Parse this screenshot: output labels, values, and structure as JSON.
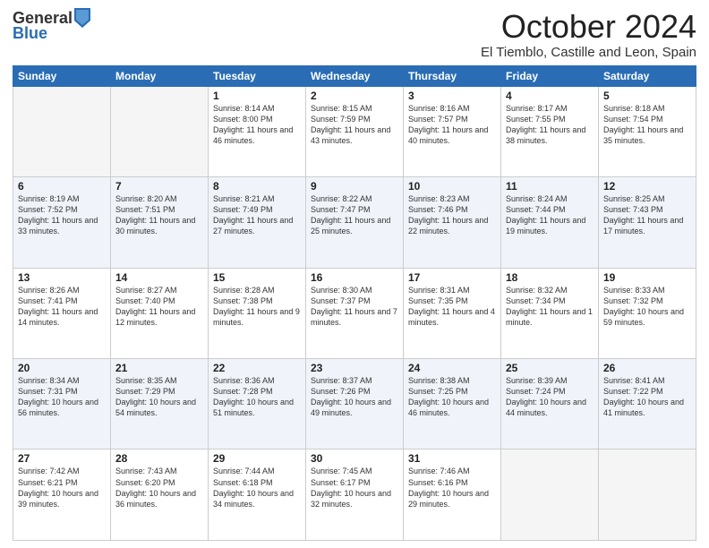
{
  "header": {
    "logo_general": "General",
    "logo_blue": "Blue",
    "month_title": "October 2024",
    "location": "El Tiemblo, Castille and Leon, Spain"
  },
  "days_of_week": [
    "Sunday",
    "Monday",
    "Tuesday",
    "Wednesday",
    "Thursday",
    "Friday",
    "Saturday"
  ],
  "weeks": [
    {
      "days": [
        {
          "num": "",
          "info": ""
        },
        {
          "num": "",
          "info": ""
        },
        {
          "num": "1",
          "info": "Sunrise: 8:14 AM\nSunset: 8:00 PM\nDaylight: 11 hours and 46 minutes."
        },
        {
          "num": "2",
          "info": "Sunrise: 8:15 AM\nSunset: 7:59 PM\nDaylight: 11 hours and 43 minutes."
        },
        {
          "num": "3",
          "info": "Sunrise: 8:16 AM\nSunset: 7:57 PM\nDaylight: 11 hours and 40 minutes."
        },
        {
          "num": "4",
          "info": "Sunrise: 8:17 AM\nSunset: 7:55 PM\nDaylight: 11 hours and 38 minutes."
        },
        {
          "num": "5",
          "info": "Sunrise: 8:18 AM\nSunset: 7:54 PM\nDaylight: 11 hours and 35 minutes."
        }
      ]
    },
    {
      "days": [
        {
          "num": "6",
          "info": "Sunrise: 8:19 AM\nSunset: 7:52 PM\nDaylight: 11 hours and 33 minutes."
        },
        {
          "num": "7",
          "info": "Sunrise: 8:20 AM\nSunset: 7:51 PM\nDaylight: 11 hours and 30 minutes."
        },
        {
          "num": "8",
          "info": "Sunrise: 8:21 AM\nSunset: 7:49 PM\nDaylight: 11 hours and 27 minutes."
        },
        {
          "num": "9",
          "info": "Sunrise: 8:22 AM\nSunset: 7:47 PM\nDaylight: 11 hours and 25 minutes."
        },
        {
          "num": "10",
          "info": "Sunrise: 8:23 AM\nSunset: 7:46 PM\nDaylight: 11 hours and 22 minutes."
        },
        {
          "num": "11",
          "info": "Sunrise: 8:24 AM\nSunset: 7:44 PM\nDaylight: 11 hours and 19 minutes."
        },
        {
          "num": "12",
          "info": "Sunrise: 8:25 AM\nSunset: 7:43 PM\nDaylight: 11 hours and 17 minutes."
        }
      ]
    },
    {
      "days": [
        {
          "num": "13",
          "info": "Sunrise: 8:26 AM\nSunset: 7:41 PM\nDaylight: 11 hours and 14 minutes."
        },
        {
          "num": "14",
          "info": "Sunrise: 8:27 AM\nSunset: 7:40 PM\nDaylight: 11 hours and 12 minutes."
        },
        {
          "num": "15",
          "info": "Sunrise: 8:28 AM\nSunset: 7:38 PM\nDaylight: 11 hours and 9 minutes."
        },
        {
          "num": "16",
          "info": "Sunrise: 8:30 AM\nSunset: 7:37 PM\nDaylight: 11 hours and 7 minutes."
        },
        {
          "num": "17",
          "info": "Sunrise: 8:31 AM\nSunset: 7:35 PM\nDaylight: 11 hours and 4 minutes."
        },
        {
          "num": "18",
          "info": "Sunrise: 8:32 AM\nSunset: 7:34 PM\nDaylight: 11 hours and 1 minute."
        },
        {
          "num": "19",
          "info": "Sunrise: 8:33 AM\nSunset: 7:32 PM\nDaylight: 10 hours and 59 minutes."
        }
      ]
    },
    {
      "days": [
        {
          "num": "20",
          "info": "Sunrise: 8:34 AM\nSunset: 7:31 PM\nDaylight: 10 hours and 56 minutes."
        },
        {
          "num": "21",
          "info": "Sunrise: 8:35 AM\nSunset: 7:29 PM\nDaylight: 10 hours and 54 minutes."
        },
        {
          "num": "22",
          "info": "Sunrise: 8:36 AM\nSunset: 7:28 PM\nDaylight: 10 hours and 51 minutes."
        },
        {
          "num": "23",
          "info": "Sunrise: 8:37 AM\nSunset: 7:26 PM\nDaylight: 10 hours and 49 minutes."
        },
        {
          "num": "24",
          "info": "Sunrise: 8:38 AM\nSunset: 7:25 PM\nDaylight: 10 hours and 46 minutes."
        },
        {
          "num": "25",
          "info": "Sunrise: 8:39 AM\nSunset: 7:24 PM\nDaylight: 10 hours and 44 minutes."
        },
        {
          "num": "26",
          "info": "Sunrise: 8:41 AM\nSunset: 7:22 PM\nDaylight: 10 hours and 41 minutes."
        }
      ]
    },
    {
      "days": [
        {
          "num": "27",
          "info": "Sunrise: 7:42 AM\nSunset: 6:21 PM\nDaylight: 10 hours and 39 minutes."
        },
        {
          "num": "28",
          "info": "Sunrise: 7:43 AM\nSunset: 6:20 PM\nDaylight: 10 hours and 36 minutes."
        },
        {
          "num": "29",
          "info": "Sunrise: 7:44 AM\nSunset: 6:18 PM\nDaylight: 10 hours and 34 minutes."
        },
        {
          "num": "30",
          "info": "Sunrise: 7:45 AM\nSunset: 6:17 PM\nDaylight: 10 hours and 32 minutes."
        },
        {
          "num": "31",
          "info": "Sunrise: 7:46 AM\nSunset: 6:16 PM\nDaylight: 10 hours and 29 minutes."
        },
        {
          "num": "",
          "info": ""
        },
        {
          "num": "",
          "info": ""
        }
      ]
    }
  ]
}
